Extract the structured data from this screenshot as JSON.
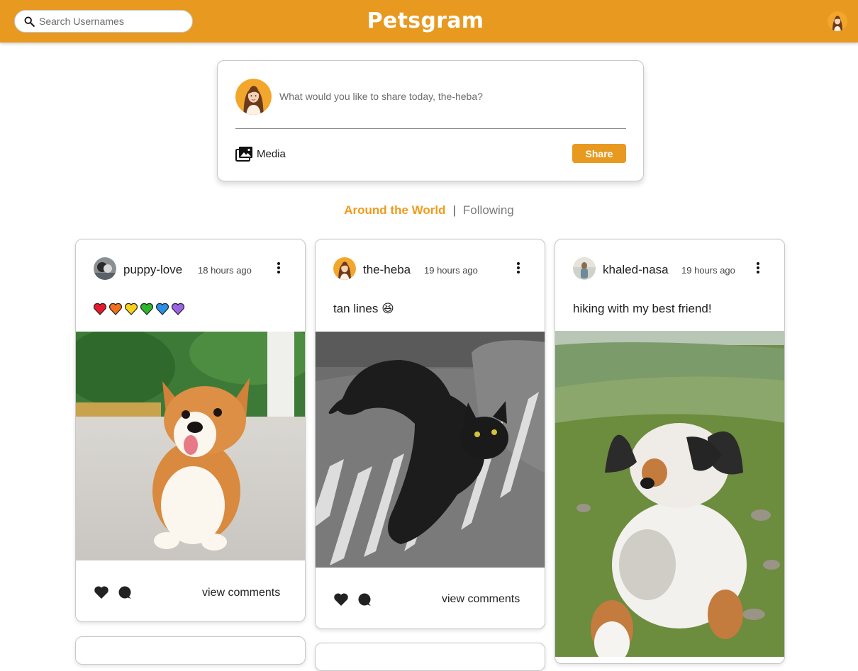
{
  "header": {
    "brand": "Petsgram",
    "search_placeholder": "Search Usernames"
  },
  "composer": {
    "placeholder": "What would you like to share today, the-heba?",
    "media_label": "Media",
    "share_label": "Share"
  },
  "feed_tabs": {
    "active": "Around the World",
    "separator": "|",
    "inactive": "Following"
  },
  "posts": [
    {
      "username": "puppy-love",
      "time": "18 hours ago",
      "caption_hearts": [
        "red",
        "orange",
        "yellow",
        "green",
        "blue",
        "purple"
      ],
      "heart_colors": [
        "#e8192c",
        "#f0701c",
        "#f8d21a",
        "#2cb62c",
        "#2b8fe6",
        "#9b64e6"
      ],
      "photo": "corgi puppy",
      "view_comments": "view comments"
    },
    {
      "username": "the-heba",
      "time": "19 hours ago",
      "caption": "tan lines",
      "caption_emoji": "😆",
      "photo": "black cat on grey couch",
      "view_comments": "view comments"
    },
    {
      "username": "khaled-nasa",
      "time": "19 hours ago",
      "caption": "hiking with my best friend!",
      "photo": "australian shepherd on hillside",
      "view_comments": "view comments"
    }
  ],
  "colors": {
    "brand": "#e8991f",
    "tab_active": "#f29a1c"
  }
}
